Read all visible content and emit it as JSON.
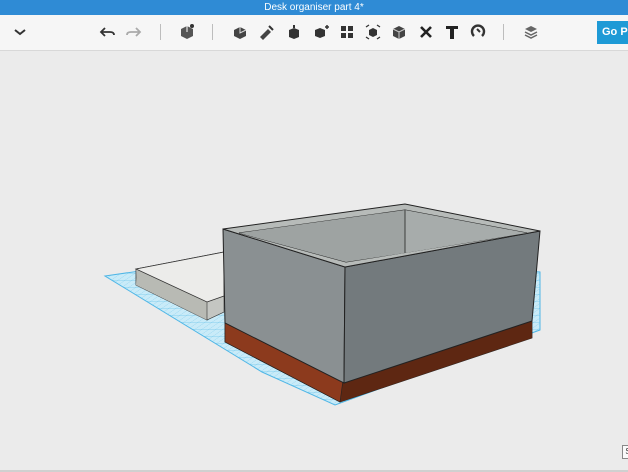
{
  "window": {
    "title": "Desk organiser part 4*"
  },
  "toolbar": {
    "menu_icon": "chevron-down-icon",
    "undo_icon": "undo-icon",
    "redo_icon": "redo-icon",
    "tools": [
      "primitives-icon",
      "sketch-icon",
      "construct-icon",
      "modify-icon",
      "pattern-icon",
      "grouping-icon",
      "combine-icon",
      "measure-icon",
      "delete-icon",
      "text-icon",
      "snap-icon"
    ],
    "material_icon": "material-icon",
    "go_pro_label": "Go Pr"
  },
  "viewport": {
    "corner_label": "S"
  },
  "colors": {
    "titlebar": "#2f8bd5",
    "go_pro": "#1e9ad6",
    "box_gray": "#7c8387",
    "base_brown": "#6b2b17",
    "grid_blue": "#4fb6e6"
  }
}
